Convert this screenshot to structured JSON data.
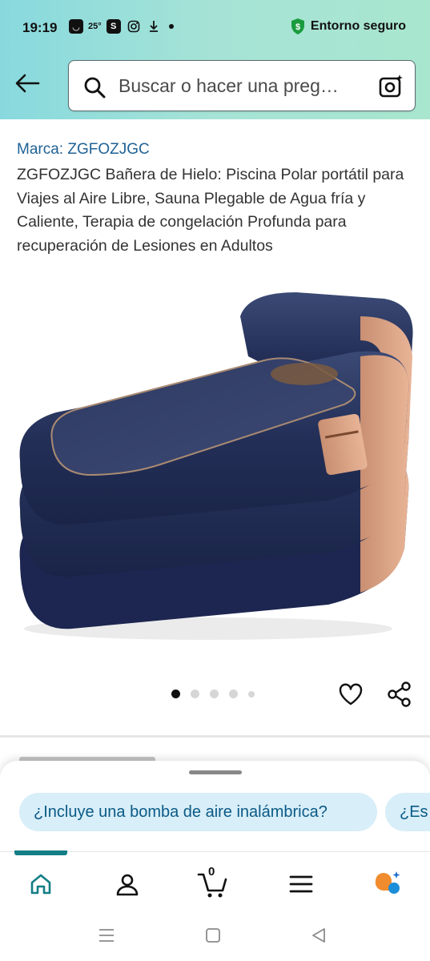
{
  "status_bar": {
    "time": "19:19",
    "temperature": "25°",
    "secure_label": "Entorno seguro"
  },
  "search": {
    "placeholder": "Buscar o hacer una preg…"
  },
  "product": {
    "brand": "Marca: ZGFOZJGC",
    "title": "ZGFOZJGC Bañera de Hielo: Piscina Polar portátil para Viajes al Aire Libre, Sauna Plegable de Agua fría y Caliente, Terapia de congelación Profunda para recuperación de Lesiones en Adultos",
    "image_alt": "inflatable-ice-bath-tub",
    "carousel": {
      "total": 5,
      "active": 1
    }
  },
  "suggestions": [
    "¿Incluye una bomba de aire inalámbrica?",
    "¿Es a"
  ],
  "bottom_nav": {
    "items": [
      "home-icon",
      "account-icon",
      "cart-icon",
      "menu-icon",
      "rufus-icon"
    ],
    "cart_count": "0",
    "accent": "#137e86"
  },
  "colors": {
    "brand_link": "#1f6296",
    "chip_bg": "#d8eef8",
    "chip_text": "#0a5a86",
    "secure_green": "#1a9c3e"
  }
}
